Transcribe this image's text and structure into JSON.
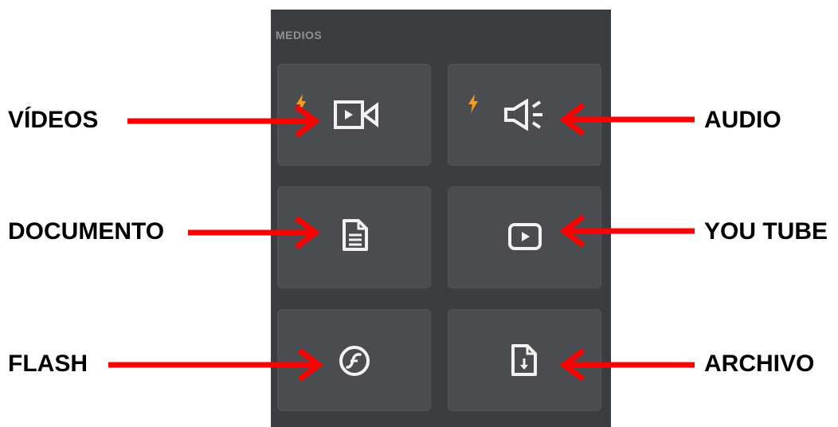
{
  "panel": {
    "title": "MEDIOS"
  },
  "tiles": [
    {
      "id": "videos",
      "icon": "video-camera-icon",
      "flash_badge": true
    },
    {
      "id": "audio",
      "icon": "speaker-icon",
      "flash_badge": true
    },
    {
      "id": "documento",
      "icon": "document-icon",
      "flash_badge": false
    },
    {
      "id": "youtube",
      "icon": "play-button-icon",
      "flash_badge": false
    },
    {
      "id": "flash",
      "icon": "flash-icon",
      "flash_badge": false
    },
    {
      "id": "archivo",
      "icon": "file-download-icon",
      "flash_badge": false
    }
  ],
  "annotations": {
    "videos": "VÍDEOS",
    "audio": "AUDIO",
    "documento": "DOCUMENTO",
    "youtube": "YOU TUBE",
    "flash": "FLASH",
    "archivo": "ARCHIVO"
  },
  "colors": {
    "panel_bg": "#3b3d40",
    "tile_bg": "#4a4c50",
    "icon": "#f2f2f2",
    "bolt": "#f39c1f",
    "arrow": "#ff0000"
  }
}
